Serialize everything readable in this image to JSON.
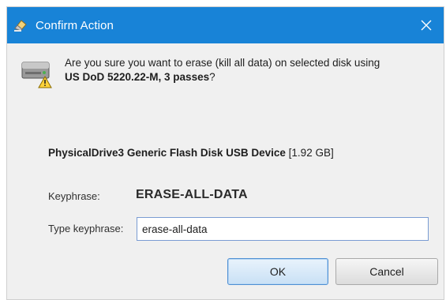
{
  "window": {
    "title": "Confirm Action",
    "title_icon": "eraser-shield-icon",
    "close_icon": "close-icon"
  },
  "message": {
    "line1": "Are you sure you want to erase (kill all data) on selected disk using",
    "method": "US DoD 5220.22-M, 3 passes",
    "suffix": "?"
  },
  "device": {
    "name": "PhysicalDrive3 Generic Flash Disk USB Device",
    "size": "[1.92 GB]",
    "icon": "disk-warning-icon"
  },
  "keyphrase": {
    "label": "Keyphrase:",
    "value": "ERASE-ALL-DATA"
  },
  "type_keyphrase": {
    "label": "Type keyphrase:",
    "value": "erase-all-data"
  },
  "buttons": {
    "ok": "OK",
    "cancel": "Cancel"
  },
  "colors": {
    "titlebar": "#1883d7",
    "dialog_bg": "#f0f0f0",
    "ok_border": "#4e8fd3"
  }
}
